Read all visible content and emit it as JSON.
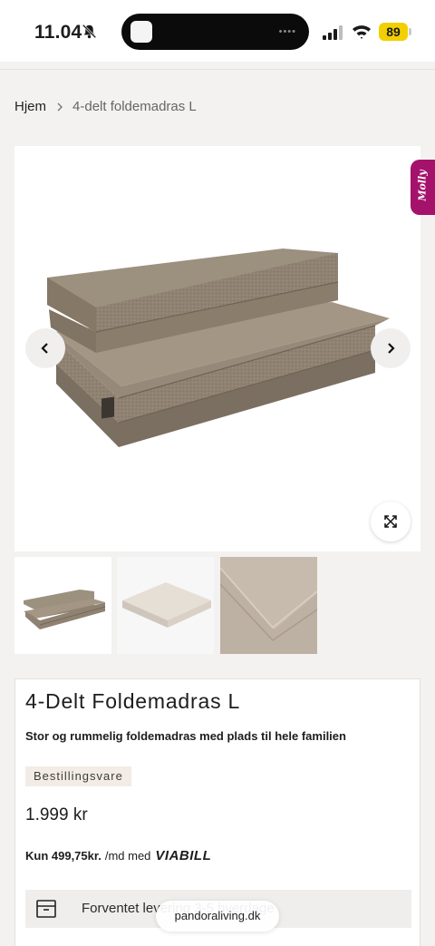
{
  "status_bar": {
    "time": "11.04",
    "battery": "89",
    "colors": {
      "battery": "#f2d000"
    }
  },
  "breadcrumb": {
    "home": "Hjem",
    "current": "4-delt foldemadras L"
  },
  "gallery": {
    "chat_widget_label": "Molly",
    "icons": [
      "chevron-left-icon",
      "chevron-right-icon",
      "expand-icon"
    ]
  },
  "product": {
    "title": "4-Delt Foldemadras L",
    "subtitle": "Stor og rummelig foldemadras med plads til hele familien",
    "badge": "Bestillingsvare",
    "price": "1.999 kr",
    "installment": {
      "amount": "Kun 499,75kr.",
      "suffix": "/md med",
      "provider": "VIABILL"
    },
    "delivery_text": "Forventet levering 3-5 hverdage"
  },
  "browser": {
    "url": "pandoraliving.dk"
  },
  "colors": {
    "accent_molly": "#a5126b",
    "fabric": "#8f8272",
    "badge_bg": "#f3ece6"
  }
}
